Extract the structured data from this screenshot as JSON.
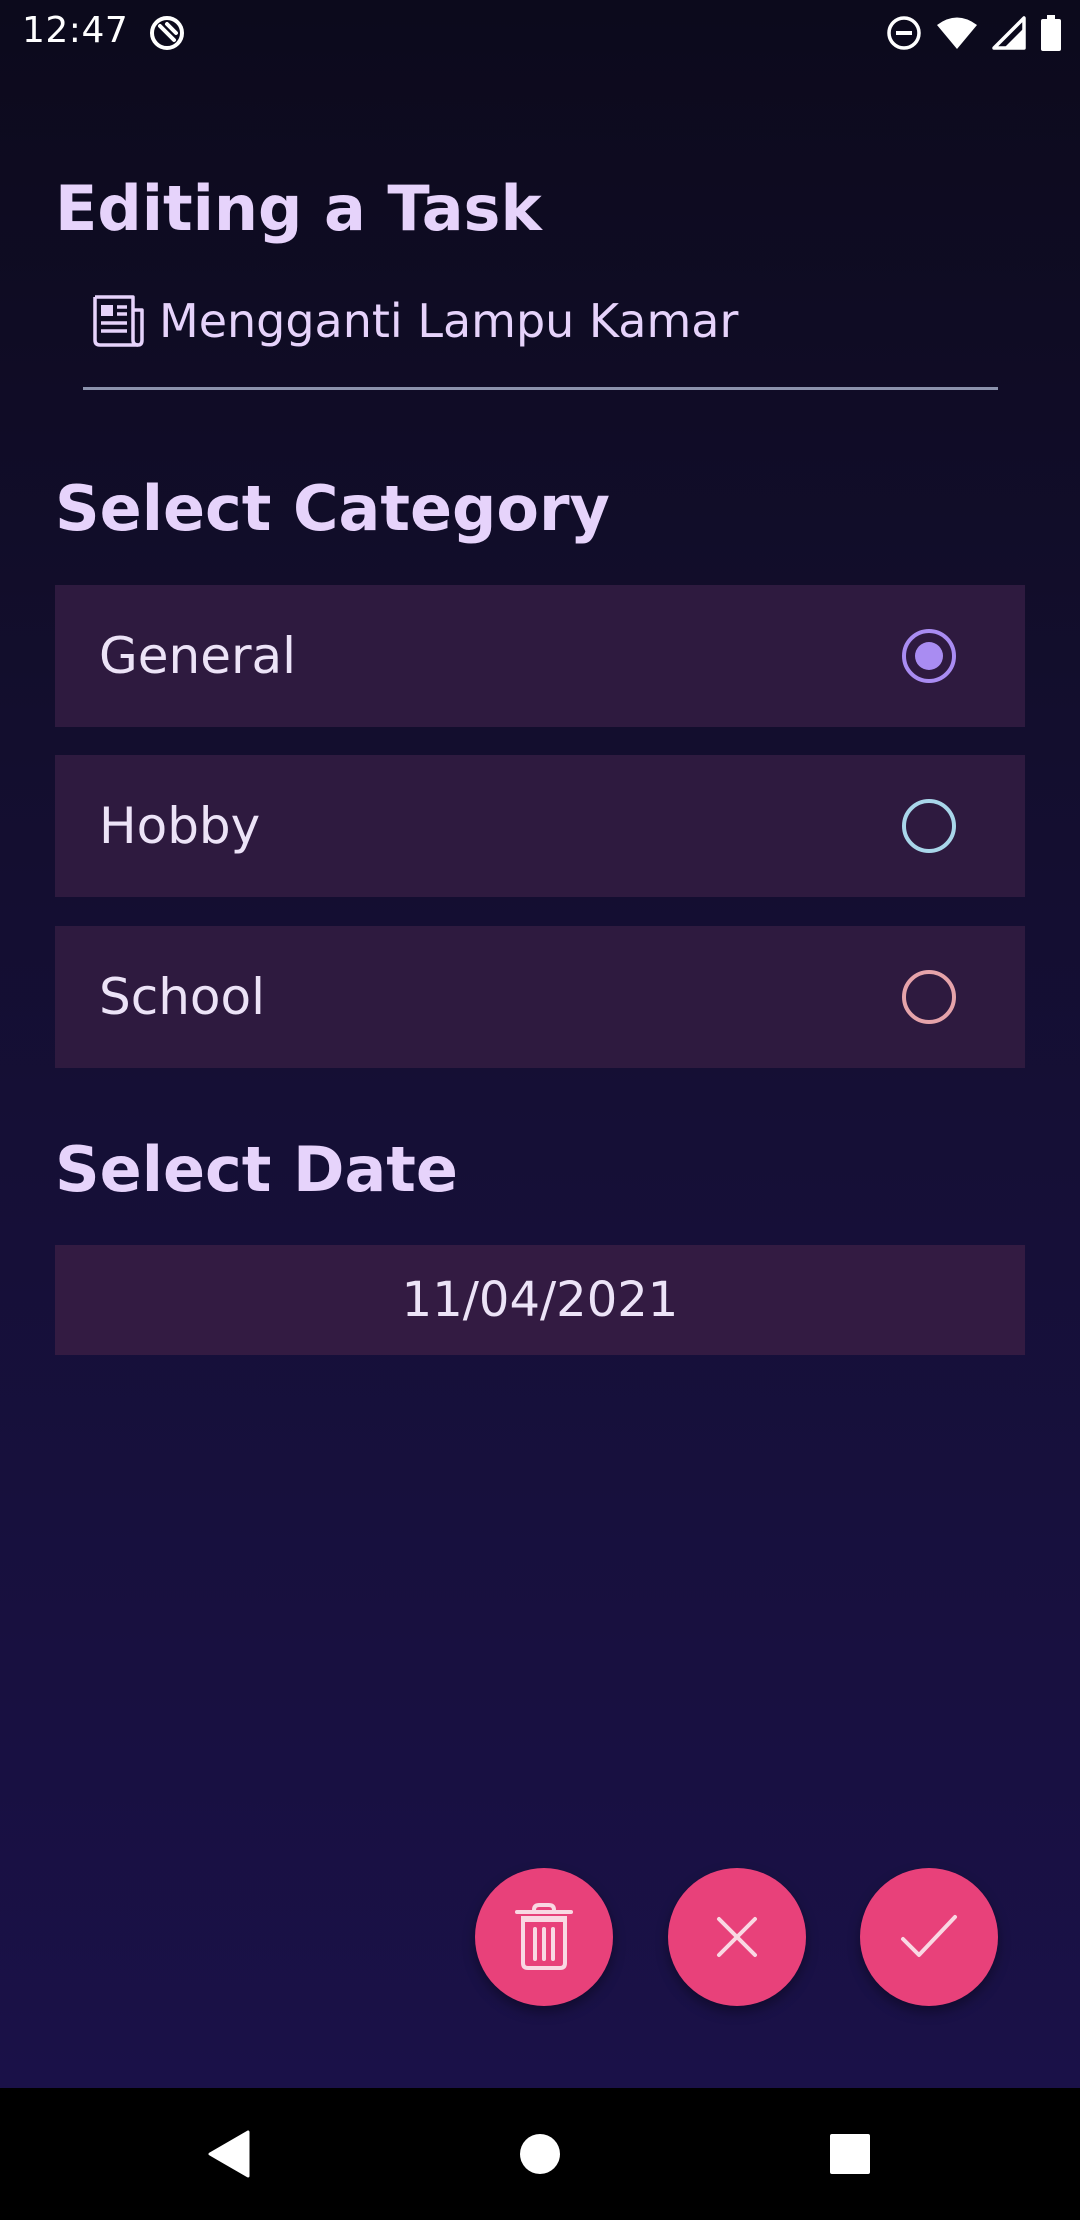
{
  "status_bar": {
    "time": "12:47"
  },
  "header": {
    "title": "Editing a Task"
  },
  "task": {
    "value": "Mengganti Lampu Kamar"
  },
  "category_section": {
    "title": "Select Category",
    "options": [
      {
        "label": "General",
        "selected": true,
        "color": "#a98cf2"
      },
      {
        "label": "Hobby",
        "selected": false,
        "color": "#a9d6ea"
      },
      {
        "label": "School",
        "selected": false,
        "color": "#e6a3aa"
      }
    ]
  },
  "date_section": {
    "title": "Select Date",
    "value": "11/04/2021"
  },
  "actions": {
    "accent_color": "#e8417a",
    "delete_icon": "trash-icon",
    "cancel_icon": "close-icon",
    "confirm_icon": "check-icon"
  }
}
